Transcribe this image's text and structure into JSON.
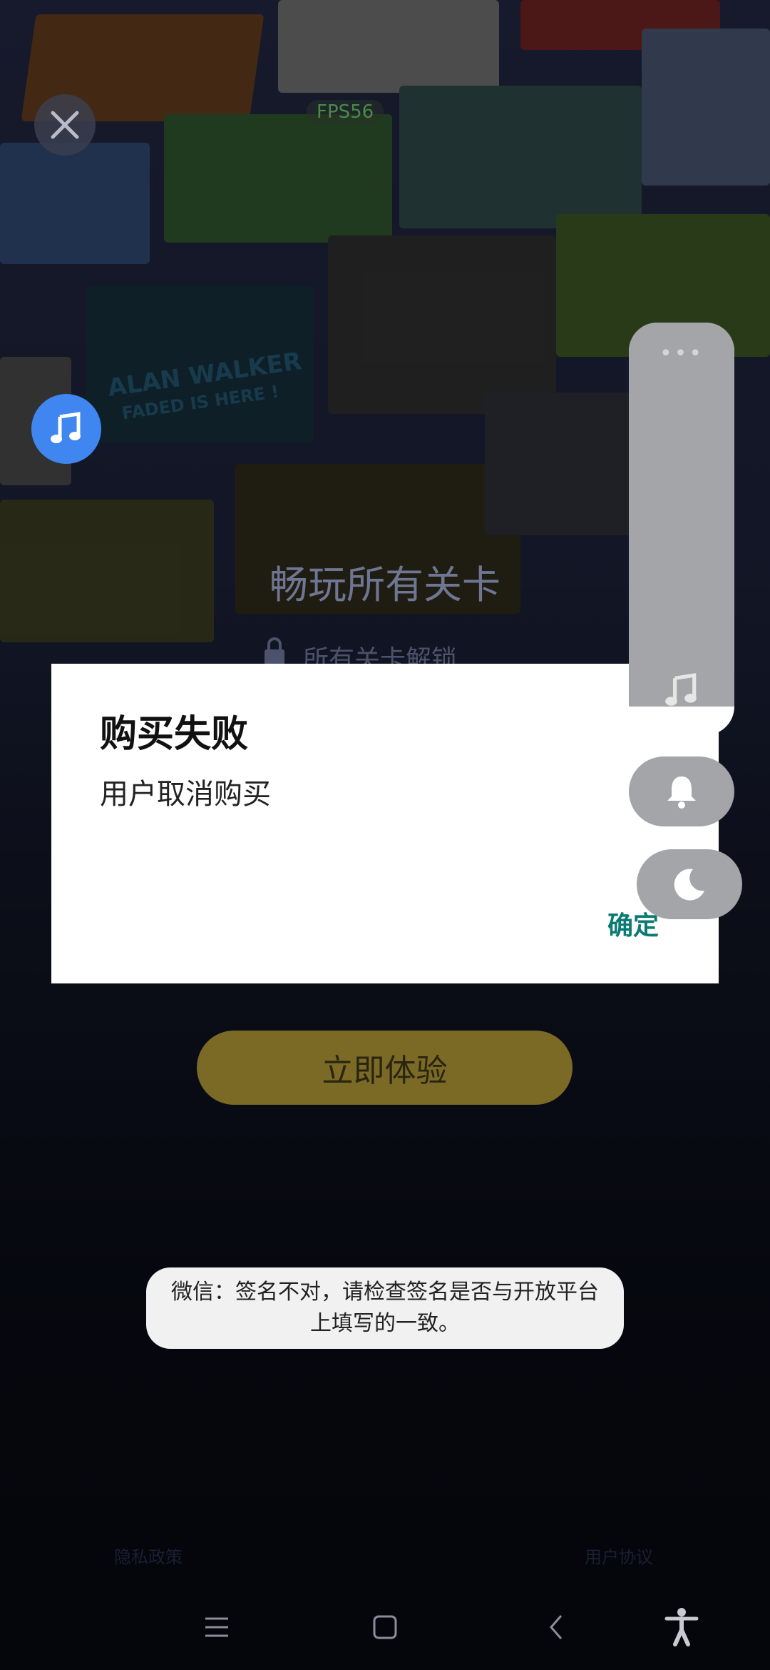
{
  "game": {
    "fps_label": "FPS56",
    "banner_text": "ALAN WALKER",
    "banner_sub": "FADED IS HERE !",
    "headline": "畅玩所有关卡",
    "subline": "所有关卡解锁",
    "try_button": "立即体验",
    "footer_privacy": "隐私政策",
    "footer_terms": "用户协议"
  },
  "dialog": {
    "title": "购买失败",
    "message": "用户取消购买",
    "confirm": "确定"
  },
  "toast": {
    "text": "微信：签名不对，请检查签名是否与开放平台上填写的一致。"
  },
  "side_panel": {
    "more_dots": "•••"
  },
  "colors": {
    "accent_teal": "#0b7a73",
    "fab_blue": "#3f86f0",
    "try_gold": "#7a6a26"
  }
}
